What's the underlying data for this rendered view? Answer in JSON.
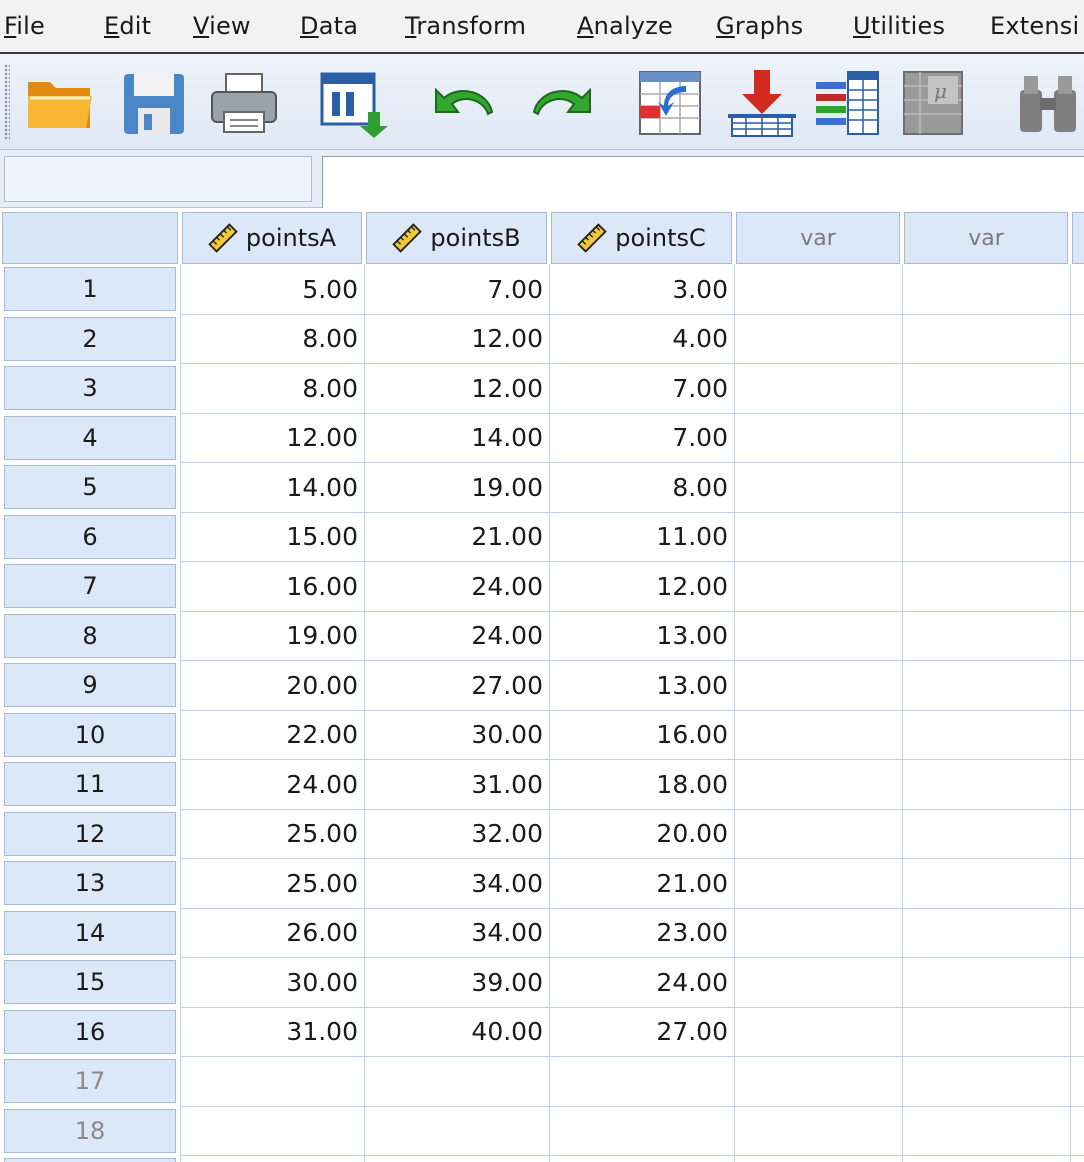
{
  "menu": [
    {
      "label": "File",
      "mnemonic": "F",
      "rest": "ile"
    },
    {
      "label": "Edit",
      "mnemonic": "E",
      "rest": "dit"
    },
    {
      "label": "View",
      "mnemonic": "V",
      "rest": "iew"
    },
    {
      "label": "Data",
      "mnemonic": "D",
      "rest": "ata"
    },
    {
      "label": "Transform",
      "mnemonic": "T",
      "rest": "ransform"
    },
    {
      "label": "Analyze",
      "mnemonic": "A",
      "rest": "nalyze"
    },
    {
      "label": "Graphs",
      "mnemonic": "G",
      "rest": "raphs"
    },
    {
      "label": "Utilities",
      "mnemonic": "U",
      "rest": "tilities"
    },
    {
      "label": "Extensi",
      "mnemonic": "",
      "rest": "Extensi"
    }
  ],
  "toolbar": [
    {
      "icon": "open-folder-icon"
    },
    {
      "icon": "save-icon"
    },
    {
      "icon": "print-icon"
    },
    {
      "icon": "dialog-recall-icon"
    },
    {
      "icon": "undo-icon"
    },
    {
      "icon": "redo-icon"
    },
    {
      "icon": "go-to-case-icon"
    },
    {
      "icon": "go-to-variable-icon"
    },
    {
      "icon": "variables-icon"
    },
    {
      "icon": "run-descriptives-icon"
    },
    {
      "icon": "find-icon"
    }
  ],
  "cell_editor": {
    "reference": "",
    "value": ""
  },
  "grid": {
    "columns": [
      {
        "name": "pointsA",
        "measure_icon": "scale-ruler-icon",
        "is_var": false
      },
      {
        "name": "pointsB",
        "measure_icon": "scale-ruler-icon",
        "is_var": false
      },
      {
        "name": "pointsC",
        "measure_icon": "scale-ruler-icon",
        "is_var": false
      },
      {
        "name": "var",
        "measure_icon": "",
        "is_var": true
      },
      {
        "name": "var",
        "measure_icon": "",
        "is_var": true
      }
    ],
    "rows": [
      {
        "n": "1",
        "values": [
          "5.00",
          "7.00",
          "3.00"
        ]
      },
      {
        "n": "2",
        "values": [
          "8.00",
          "12.00",
          "4.00"
        ]
      },
      {
        "n": "3",
        "values": [
          "8.00",
          "12.00",
          "7.00"
        ]
      },
      {
        "n": "4",
        "values": [
          "12.00",
          "14.00",
          "7.00"
        ]
      },
      {
        "n": "5",
        "values": [
          "14.00",
          "19.00",
          "8.00"
        ]
      },
      {
        "n": "6",
        "values": [
          "15.00",
          "21.00",
          "11.00"
        ]
      },
      {
        "n": "7",
        "values": [
          "16.00",
          "24.00",
          "12.00"
        ]
      },
      {
        "n": "8",
        "values": [
          "19.00",
          "24.00",
          "13.00"
        ]
      },
      {
        "n": "9",
        "values": [
          "20.00",
          "27.00",
          "13.00"
        ]
      },
      {
        "n": "10",
        "values": [
          "22.00",
          "30.00",
          "16.00"
        ]
      },
      {
        "n": "11",
        "values": [
          "24.00",
          "31.00",
          "18.00"
        ]
      },
      {
        "n": "12",
        "values": [
          "25.00",
          "32.00",
          "20.00"
        ]
      },
      {
        "n": "13",
        "values": [
          "25.00",
          "34.00",
          "21.00"
        ]
      },
      {
        "n": "14",
        "values": [
          "26.00",
          "34.00",
          "23.00"
        ]
      },
      {
        "n": "15",
        "values": [
          "30.00",
          "39.00",
          "24.00"
        ]
      },
      {
        "n": "16",
        "values": [
          "31.00",
          "40.00",
          "27.00"
        ]
      },
      {
        "n": "17",
        "values": [
          "",
          "",
          ""
        ]
      },
      {
        "n": "18",
        "values": [
          "",
          "",
          ""
        ]
      }
    ]
  }
}
